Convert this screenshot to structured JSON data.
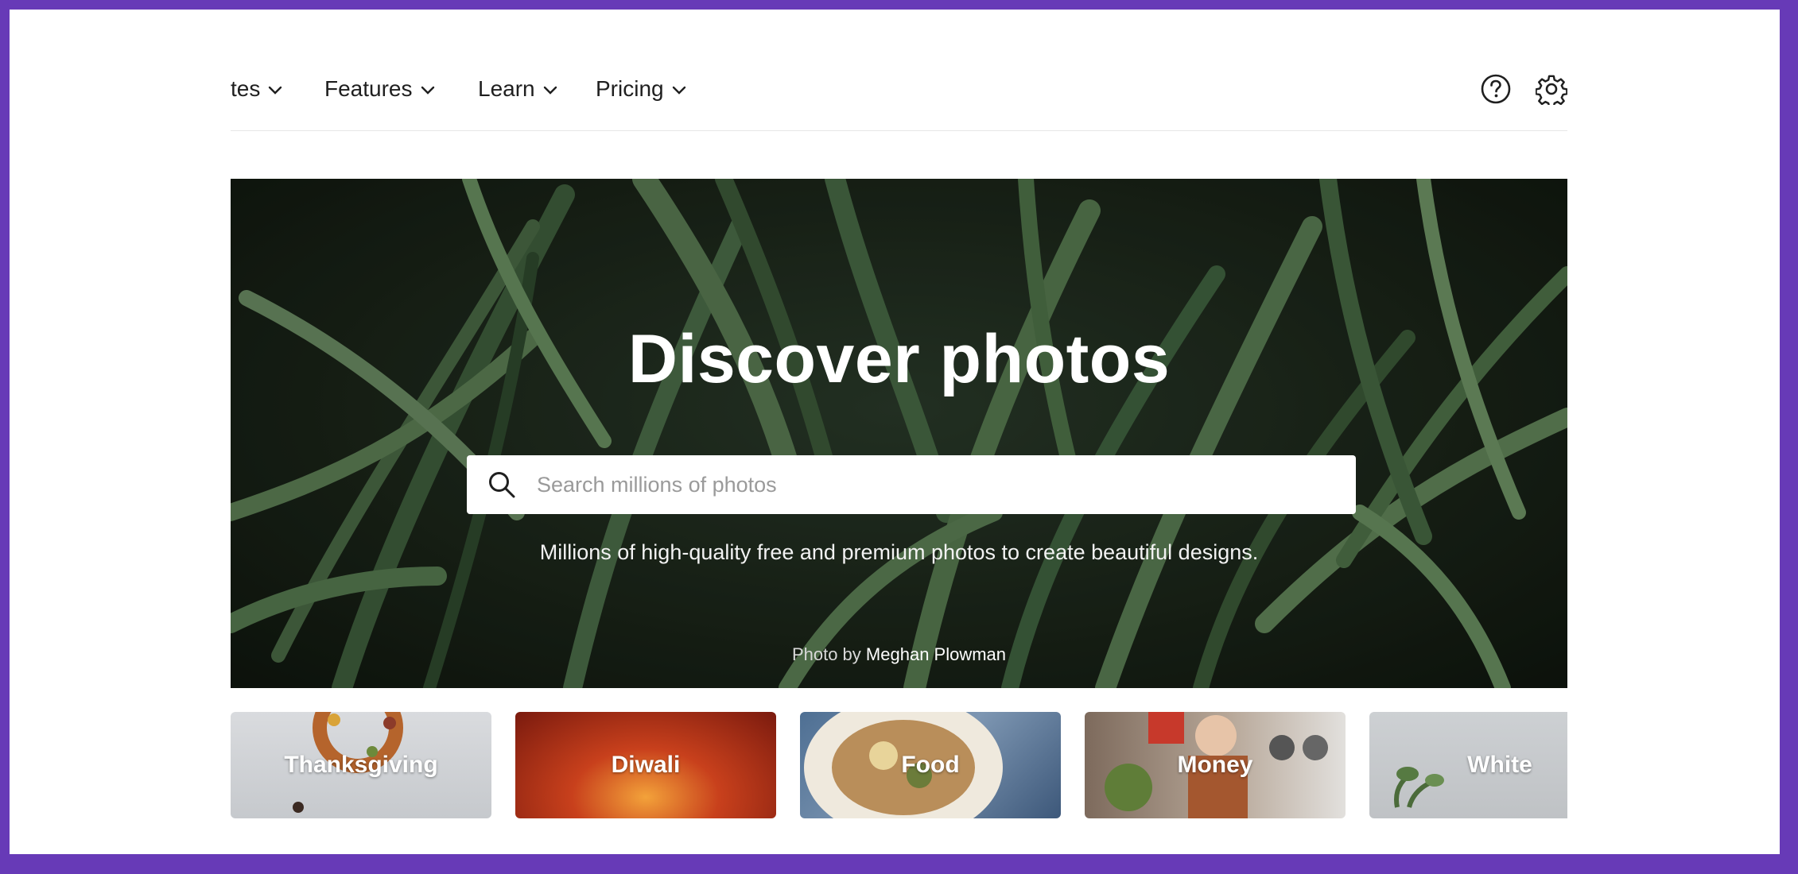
{
  "nav": {
    "items": [
      {
        "label": "tes"
      },
      {
        "label": "Features"
      },
      {
        "label": "Learn"
      },
      {
        "label": "Pricing"
      }
    ],
    "icons": [
      "help-icon",
      "gear-icon"
    ]
  },
  "hero": {
    "title": "Discover photos",
    "search_placeholder": "Search millions of photos",
    "subtitle": "Millions of high-quality free and premium photos to create beautiful designs.",
    "credit_prefix": "Photo by",
    "credit_author": "Meghan Plowman"
  },
  "categories": [
    {
      "label": "Thanksgiving",
      "color": "#c9ccd0"
    },
    {
      "label": "Diwali",
      "color": "#b3321a"
    },
    {
      "label": "Food",
      "color": "#6f8aa8"
    },
    {
      "label": "Money",
      "color": "#8f7c70"
    },
    {
      "label": "White",
      "color": "#c4c7ca"
    }
  ],
  "colors": {
    "frame_border": "#673ab7",
    "background": "#ffffff",
    "nav_text": "#1f1f1f"
  }
}
